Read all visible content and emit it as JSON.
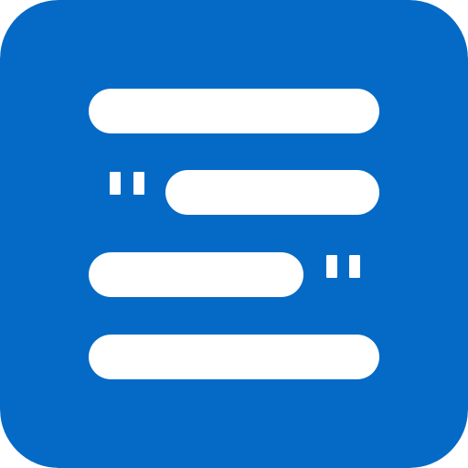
{
  "icon": {
    "name": "quote-text-lines-icon",
    "background_color": "#056AC6",
    "foreground_color": "#FFFFFF"
  }
}
